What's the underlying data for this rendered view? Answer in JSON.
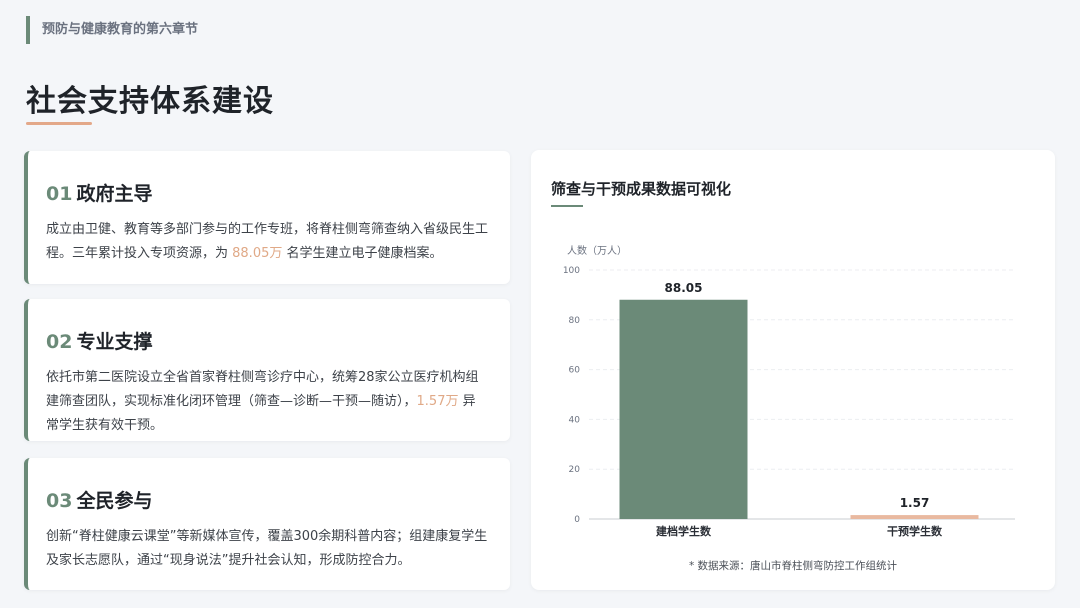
{
  "header": {
    "chapter": "预防与健康教育的第六章节",
    "title": "社会支持体系建设"
  },
  "cards": [
    {
      "num": "01",
      "title": "政府主导",
      "text_before": "成立由卫健、教育等多部门参与的工作专班，将脊柱侧弯筛查纳入省级民生工程。三年累计投入专项资源，为 ",
      "highlight": "88.05万",
      "text_after": " 名学生建立电子健康档案。"
    },
    {
      "num": "02",
      "title": "专业支撑",
      "text_before": "依托市第二医院设立全省首家脊柱侧弯诊疗中心，统筹28家公立医疗机构组建筛查团队，实现标准化闭环管理（筛查—诊断—干预—随访），",
      "highlight": "1.57万",
      "text_after": " 异常学生获有效干预。"
    },
    {
      "num": "03",
      "title": "全民参与",
      "text_before": "创新“脊柱健康云课堂”等新媒体宣传，覆盖300余期科普内容；组建康复学生及家长志愿队，通过“现身说法”提升社会认知，形成防控合力。",
      "highlight": "",
      "text_after": ""
    }
  ],
  "chart_panel": {
    "title": "筛查与干预成果数据可视化",
    "source": "* 数据来源：唐山市脊柱侧弯防控工作组统计"
  },
  "colors": {
    "accent_green": "#6b8a78",
    "accent_peach": "#e3a889"
  },
  "chart_data": {
    "type": "bar",
    "categories": [
      "建档学生数",
      "干预学生数"
    ],
    "values": [
      88.05,
      1.57
    ],
    "value_labels": [
      "88.05",
      "1.57"
    ],
    "bar_colors": [
      "#6b8a78",
      "#e9b9a0"
    ],
    "ylabel": "人数（万人）",
    "ylim": [
      0,
      100
    ],
    "yticks": [
      0,
      20,
      40,
      60,
      80,
      100
    ],
    "grid": true
  }
}
